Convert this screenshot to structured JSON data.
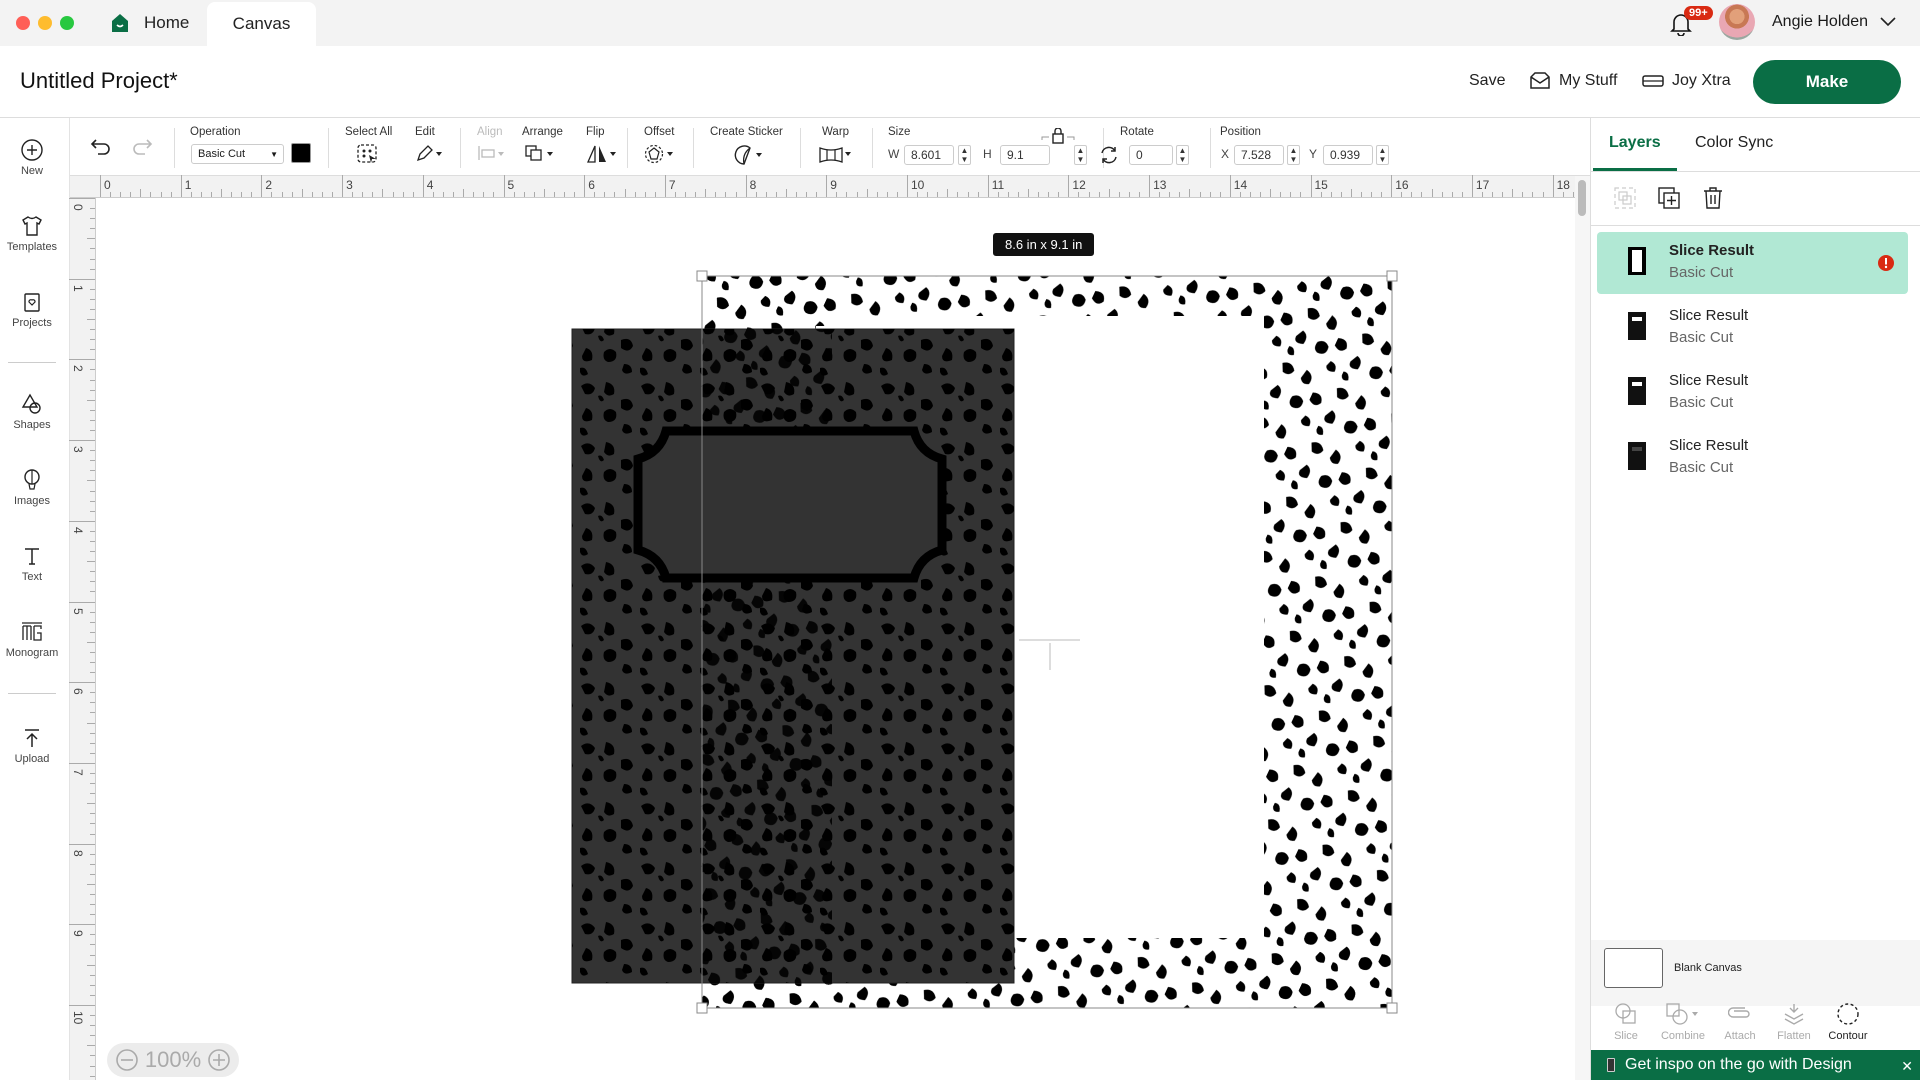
{
  "window": {
    "traffic_lights": [
      "#ff5f57",
      "#febc2e",
      "#28c840"
    ],
    "tabs": [
      {
        "label": "Home",
        "icon": "home-icon"
      },
      {
        "label": "Canvas",
        "active": true
      }
    ]
  },
  "user": {
    "notification_badge": "99+",
    "name": "Angie Holden"
  },
  "header": {
    "project_title": "Untitled Project*",
    "save_label": "Save",
    "mystuff_label": "My Stuff",
    "joyxtra_label": "Joy Xtra",
    "make_label": "Make"
  },
  "sidebar": {
    "items": [
      {
        "label": "New",
        "icon": "plus-circle-icon"
      },
      {
        "label": "Templates",
        "icon": "tshirt-icon"
      },
      {
        "label": "Projects",
        "icon": "projects-icon"
      },
      {
        "label": "Shapes",
        "icon": "shapes-icon"
      },
      {
        "label": "Images",
        "icon": "balloon-icon"
      },
      {
        "label": "Text",
        "icon": "text-icon"
      },
      {
        "label": "Monogram",
        "icon": "monogram-icon"
      },
      {
        "label": "Upload",
        "icon": "upload-icon"
      }
    ]
  },
  "toolbar": {
    "operation_label": "Operation",
    "operation_value": "Basic Cut",
    "operation_color": "#000000",
    "select_all_label": "Select All",
    "edit_label": "Edit",
    "align_label": "Align",
    "arrange_label": "Arrange",
    "flip_label": "Flip",
    "offset_label": "Offset",
    "create_sticker_label": "Create Sticker",
    "warp_label": "Warp",
    "size_label": "Size",
    "width_axis": "W",
    "width_value": "8.601",
    "height_axis": "H",
    "height_value": "9.1",
    "rotate_label": "Rotate",
    "rotate_value": "0",
    "position_label": "Position",
    "x_axis": "X",
    "x_value": "7.528",
    "y_axis": "Y",
    "y_value": "0.939"
  },
  "rulers": {
    "horizontal": [
      "0",
      "1",
      "2",
      "3",
      "4",
      "5",
      "6",
      "7",
      "8",
      "9",
      "10",
      "11",
      "12",
      "13",
      "14",
      "15",
      "16",
      "17",
      "18"
    ],
    "vertical": [
      "0",
      "1",
      "2",
      "3",
      "4",
      "5",
      "6",
      "7",
      "8",
      "9",
      "10"
    ]
  },
  "canvas": {
    "selection_size": "8.6  in x 9.1  in",
    "zoom": "100%"
  },
  "right_panel": {
    "tabs": [
      {
        "label": "Layers",
        "active": true
      },
      {
        "label": "Color Sync"
      }
    ],
    "layers": [
      {
        "name": "Slice Result",
        "operation": "Basic Cut",
        "selected": true,
        "warning": true
      },
      {
        "name": "Slice Result",
        "operation": "Basic Cut"
      },
      {
        "name": "Slice Result",
        "operation": "Basic Cut"
      },
      {
        "name": "Slice Result",
        "operation": "Basic Cut"
      }
    ],
    "blank_canvas_label": "Blank Canvas",
    "bottom_tools": [
      {
        "label": "Slice",
        "enabled": false
      },
      {
        "label": "Combine",
        "enabled": false
      },
      {
        "label": "Attach",
        "enabled": false
      },
      {
        "label": "Flatten",
        "enabled": false
      },
      {
        "label": "Contour",
        "enabled": true
      }
    ],
    "banner_text": "Get inspo on the go with Design"
  },
  "colors": {
    "brand_green": "#0a6e45",
    "selected_layer_bg": "#b1e8d4",
    "warning_red": "#d92a12",
    "artwork_dark": "#333333"
  }
}
